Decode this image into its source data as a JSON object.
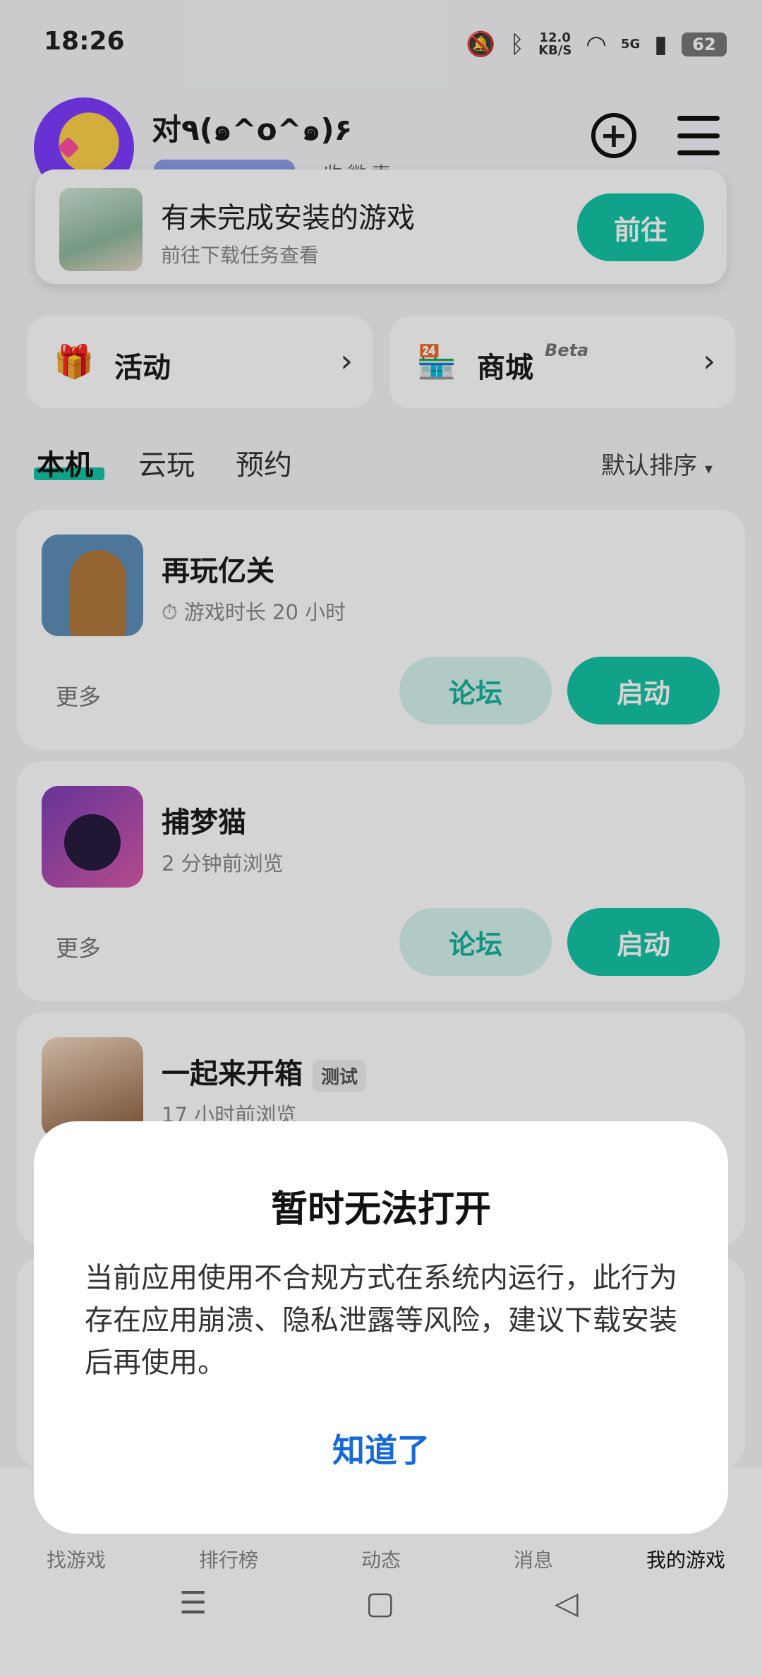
{
  "status_bar": {
    "time": "18:26",
    "net_speed_value": "12.0",
    "net_speed_unit": "KB/S",
    "signal_label": "5G",
    "battery": "62",
    "icons": [
      "mute-bell-icon",
      "bluetooth-icon",
      "wifi-icon",
      "cell-signal-icon",
      "battery-icon"
    ]
  },
  "header": {
    "username": "对٩(๑^o^๑)۶",
    "subtitle": "‹ 收 微 索 ›"
  },
  "install_notice": {
    "title": "有未完成安装的游戏",
    "subtitle": "前往下载任务查看",
    "action": "前往"
  },
  "shortcuts": [
    {
      "label": "活动",
      "icon": "gift-icon"
    },
    {
      "label": "商城",
      "badge": "Beta",
      "icon": "store-icon"
    }
  ],
  "tabs": [
    "本机",
    "云玩",
    "预约"
  ],
  "sort_label": "默认排序",
  "games": [
    {
      "title": "再玩亿关",
      "meta": "游戏时长 20 小时",
      "more": "更多",
      "forum": "论坛",
      "start": "启动"
    },
    {
      "title": "捕梦猫",
      "meta": "2 分钟前浏览",
      "more": "更多",
      "forum": "论坛",
      "start": "启动"
    },
    {
      "title": "一起来开箱",
      "badge": "测试",
      "meta": "17 小时前浏览"
    }
  ],
  "bottom_nav": [
    "找游戏",
    "排行榜",
    "动态",
    "消息",
    "我的游戏"
  ],
  "dialog": {
    "title": "暂时无法打开",
    "body": "当前应用使用不合规方式在系统内运行，此行为存在应用崩溃、隐私泄露等风险，建议下载安装后再使用。",
    "confirm": "知道了"
  },
  "colors": {
    "accent": "#15c3a6",
    "link": "#1769d6"
  }
}
